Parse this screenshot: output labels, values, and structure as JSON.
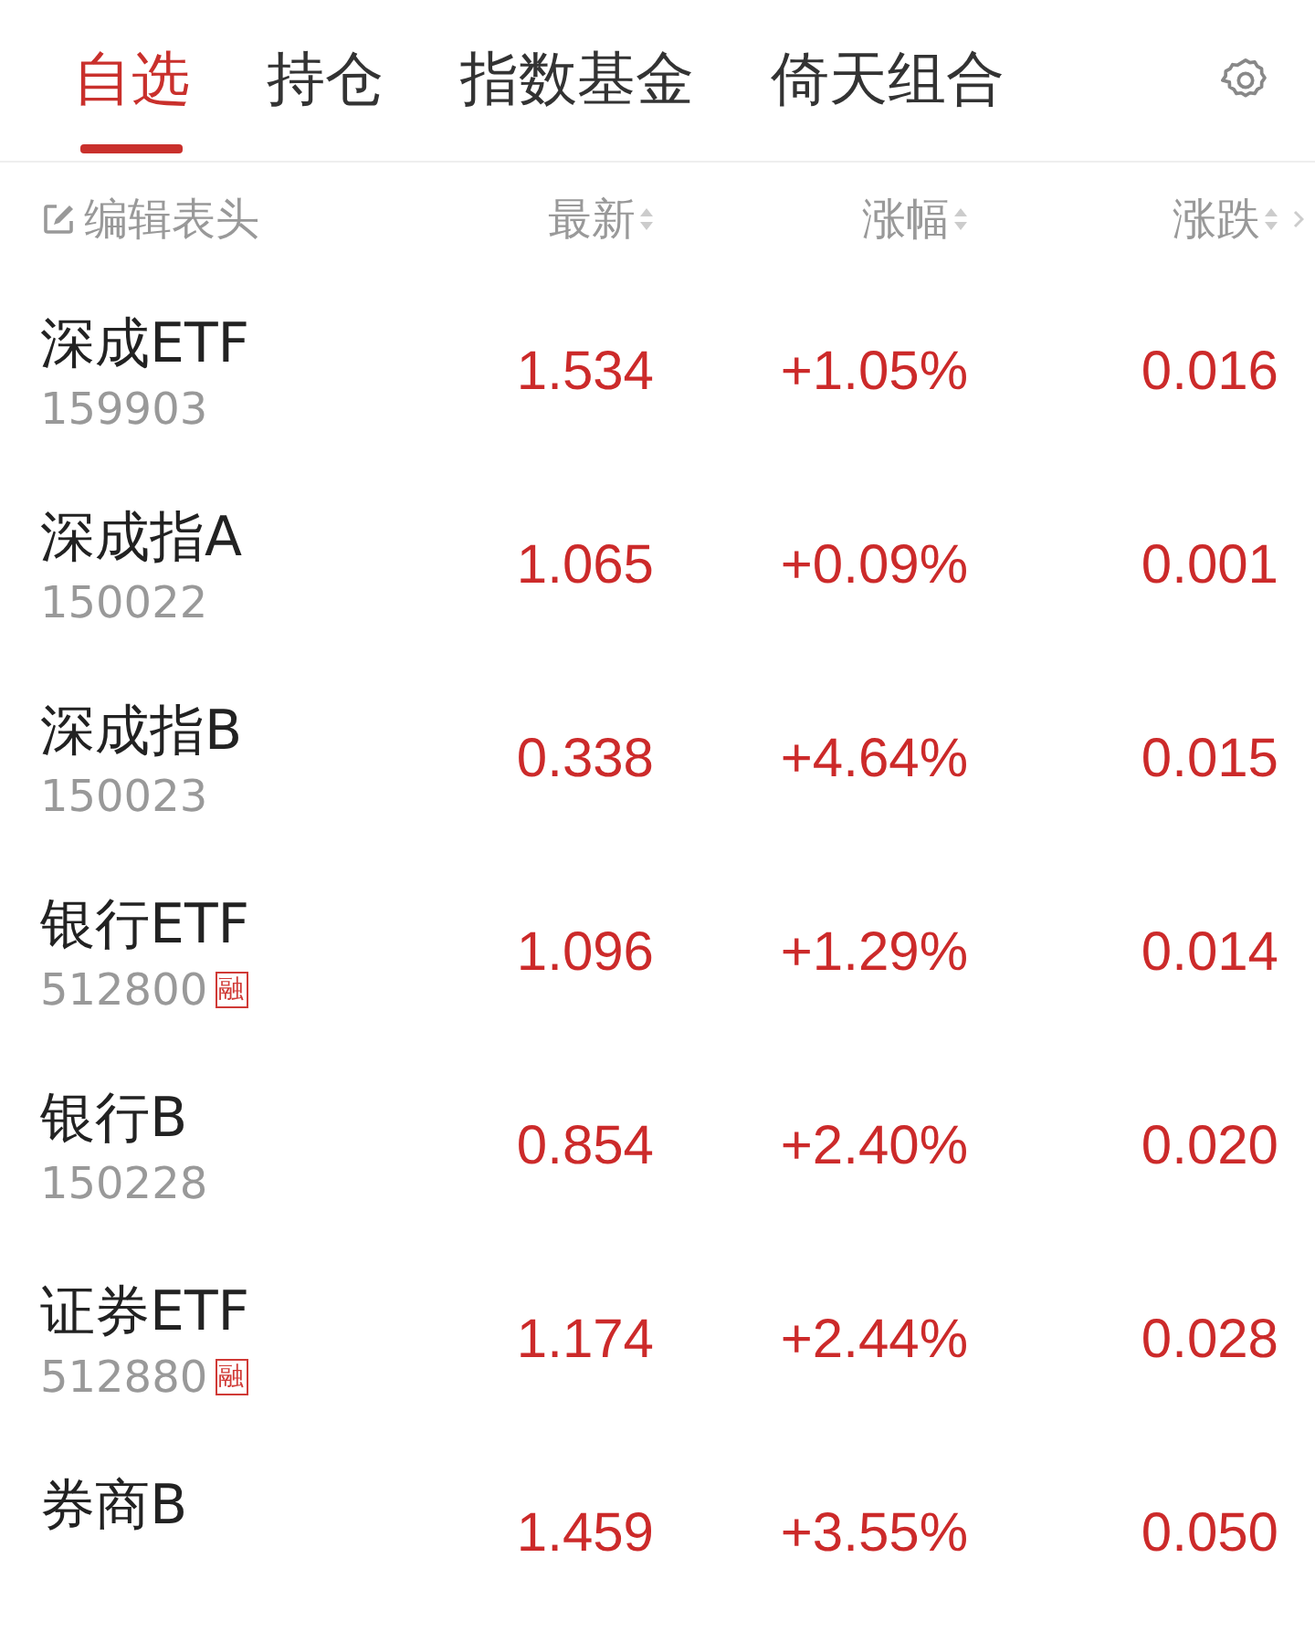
{
  "tabs": [
    {
      "label": "自选",
      "selected": true
    },
    {
      "label": "持仓",
      "selected": false
    },
    {
      "label": "指数基金",
      "selected": false
    },
    {
      "label": "倚天组合",
      "selected": false
    }
  ],
  "header": {
    "edit_label": "编辑表头",
    "columns": [
      "最新",
      "涨幅",
      "涨跌"
    ]
  },
  "rows": [
    {
      "name": "深成ETF",
      "code": "159903",
      "latest": "1.534",
      "change_pct": "+1.05%",
      "change": "0.016"
    },
    {
      "name": "深成指A",
      "code": "150022",
      "latest": "1.065",
      "change_pct": "+0.09%",
      "change": "0.001"
    },
    {
      "name": "深成指B",
      "code": "150023",
      "latest": "0.338",
      "change_pct": "+4.64%",
      "change": "0.015"
    },
    {
      "name": "银行ETF",
      "code": "512800",
      "tag": "融",
      "latest": "1.096",
      "change_pct": "+1.29%",
      "change": "0.014"
    },
    {
      "name": "银行B",
      "code": "150228",
      "latest": "0.854",
      "change_pct": "+2.40%",
      "change": "0.020"
    },
    {
      "name": "证券ETF",
      "code": "512880",
      "tag": "融",
      "latest": "1.174",
      "change_pct": "+2.44%",
      "change": "0.028"
    },
    {
      "name": "券商B",
      "latest": "1.459",
      "change_pct": "+3.55%",
      "change": "0.050"
    }
  ]
}
